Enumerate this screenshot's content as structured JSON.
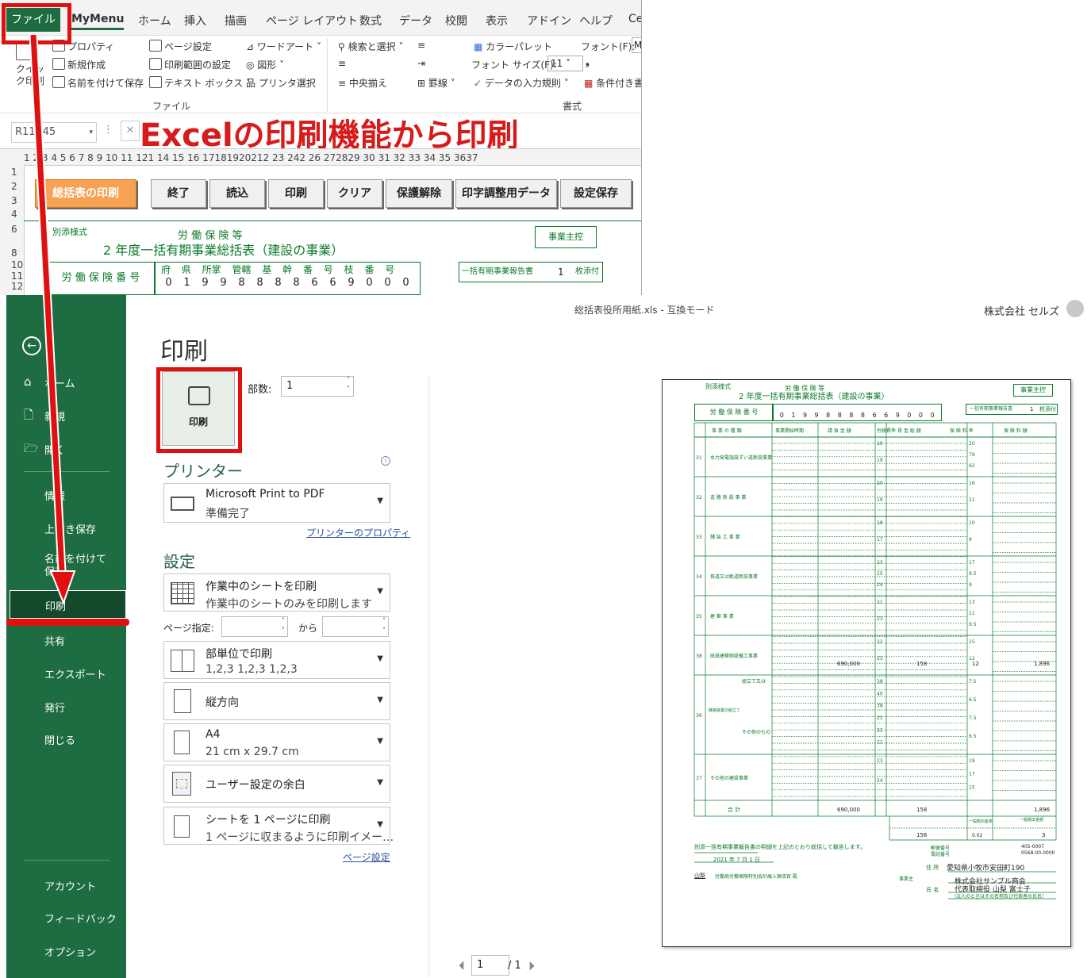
{
  "ribbon": {
    "tabs": [
      "ファイル",
      "MyMenu",
      "ホーム",
      "挿入",
      "描画",
      "ページ レイアウト",
      "数式",
      "データ",
      "校閲",
      "表示",
      "アドイン",
      "ヘルプ",
      "Ce"
    ],
    "quick_print": "クイック印刷",
    "file_group": [
      "プロパティ",
      "新規作成",
      "名前を付けて保存",
      "ページ設定",
      "印刷範囲の設定",
      "テキスト ボックス",
      "ワードアート",
      "図形",
      "プリンタ選択"
    ],
    "edit_group": [
      "検索と選択",
      "中央揃え",
      "罫線"
    ],
    "format_group": [
      "カラーパレット",
      "フォント サイズ(F):",
      "11",
      "データの入力規則",
      "フォント(F):",
      "M",
      "条件付き書"
    ],
    "group_file": "ファイル",
    "group_format": "書式",
    "name_box": "R11C45",
    "col_numbers": "1 2   3   4 5 6 7 8  9  10 11 121 14 15 16 17181920212 23 242 26 272829  30   31 32 33  34   35 3637",
    "overlay_title": "Excelの印刷機能から印刷"
  },
  "sheet": {
    "buttons": [
      "総括表の印刷",
      "終了",
      "読込",
      "印刷",
      "クリア",
      "保護解除",
      "印字調整用データ",
      "設定保存"
    ],
    "rows": [
      "1",
      "2",
      "3",
      "4",
      "6",
      "8",
      "10",
      "11",
      "12"
    ],
    "form_label": "別添様式",
    "form_title_top": "労 働 保 険 等",
    "form_title": "2  年度一括有期事業総括表（建設の事業）",
    "jigyo_box": "事業主控",
    "insurance_label": "労 働 保 険 番 号",
    "insurance_headers": [
      "府 県",
      "所掌",
      "管轄",
      "基  幹  番  号",
      "枝  番  号"
    ],
    "insurance_digits": [
      "0",
      "1",
      "9",
      "9",
      "8",
      "8",
      "8",
      "8",
      "6",
      "6",
      "9",
      "0",
      "0",
      "0"
    ],
    "attach_label": "一括有期事業報告書",
    "attach_count": "1",
    "attach_unit": "枚添付"
  },
  "backstage": {
    "window_title": "総括表役所用紙.xls  -  互換モード",
    "company": "株式会社 セルズ",
    "nav": [
      "ホーム",
      "新規",
      "開く",
      "情報",
      "上書き保存",
      "名前を付けて保存",
      "印刷",
      "共有",
      "エクスポート",
      "発行",
      "閉じる",
      "アカウント",
      "フィードバック",
      "オプション"
    ],
    "heading": "印刷",
    "print_button": "印刷",
    "copies_label": "部数:",
    "copies_value": "1",
    "printer_heading": "プリンター",
    "printer_name": "Microsoft Print to PDF",
    "printer_status": "準備完了",
    "printer_props": "プリンターのプロパティ",
    "settings_heading": "設定",
    "settings": [
      {
        "l1": "作業中のシートを印刷",
        "l2": "作業中のシートのみを印刷します"
      },
      {
        "l1": "部単位で印刷",
        "l2": "1,2,3    1,2,3    1,2,3"
      },
      {
        "l1": "縦方向",
        "l2": ""
      },
      {
        "l1": "A4",
        "l2": "21 cm x 29.7 cm"
      },
      {
        "l1": "ユーザー設定の余白",
        "l2": ""
      },
      {
        "l1": "シートを 1 ページに印刷",
        "l2": "1 ページに収まるように印刷イメー…"
      }
    ],
    "pages_label": "ページ指定:",
    "pages_to": "から",
    "page_setup": "ページ設定",
    "page_current": "1",
    "page_total": "/ 1"
  },
  "preview": {
    "label": "別添様式",
    "title_top": "労 働 保 険 等",
    "title": "2  年度一括有期事業総括表（建設の事業）",
    "box": "事業主控",
    "insurance_label": "労 働 保 険 番 号",
    "digits": [
      "0",
      "1",
      "9",
      "9",
      "8",
      "8",
      "8",
      "8",
      "6",
      "6",
      "9",
      "0",
      "0",
      "0"
    ],
    "attach": "一括有期事業報告書",
    "attach_count": "1",
    "attach_unit": "枚添付",
    "headers": [
      "事 業 の 種 類",
      "事業開始時期",
      "請 負 金 額",
      "労務費率",
      "賃 金 総 額",
      "保 険 料 率",
      "保 険 料 額"
    ],
    "rows": [
      {
        "code": "31",
        "name": "水力発電施設ずい道新設事業",
        "rates": [
          "19",
          "19"
        ],
        "prate": [
          "20",
          "79",
          "62"
        ]
      },
      {
        "code": "32",
        "name": "道 路 新 設 事 業",
        "rates": [
          "20",
          "19"
        ],
        "prate": [
          "16",
          "11"
        ]
      },
      {
        "code": "33",
        "name": "舗 装 工 事 業",
        "rates": [
          "18",
          "17"
        ],
        "prate": [
          "10",
          "9"
        ]
      },
      {
        "code": "34",
        "name": "鉄道又は軌道新設事業",
        "rates": [
          "23",
          "25",
          "24"
        ],
        "prate": [
          "17",
          "9.5",
          "9"
        ]
      },
      {
        "code": "35",
        "name": "建 築 事 業",
        "rates": [
          "21",
          "23"
        ],
        "prate": [
          "13",
          "11",
          "9.5"
        ]
      },
      {
        "code": "38",
        "name": "既設建築物設備工事業",
        "rates": [
          "22",
          "23"
        ],
        "prate": [
          "15",
          "12"
        ]
      },
      {
        "code": "36",
        "name": "機械装置の組立て又は据付けの事業",
        "rates": [
          "38",
          "40",
          "38",
          "21",
          "22",
          "21"
        ],
        "prate": [
          "7.5",
          "6.5",
          "7.5",
          "6.5"
        ]
      },
      {
        "code": "37",
        "name": "その他の建設事業",
        "rates": [
          "23",
          "24"
        ],
        "prate": [
          "19",
          "17",
          "15"
        ]
      }
    ],
    "sub36a": "組立て又は取付けに関するもの",
    "sub36b": "その他のもの",
    "row38_amount": "690,000",
    "row38_wage": "158",
    "row38_rate": "12",
    "row38_fee": "1,896",
    "total_label": "合   計",
    "total_amount": "690,000",
    "total_wage": "158",
    "total_fee": "1,896",
    "general_label": "一般拠出金率",
    "general_label2": "一般拠出金額",
    "general_wage": "158",
    "general_rate": "0.02",
    "general_fee": "3",
    "note": "別添一括有期事業報告書の明細を上記のとおり総括して報告します。",
    "date": "2021  年  7  月  1  日",
    "office": "山梨",
    "office_suffix": "労働局労働保険特別会計歳入徴収官  殿",
    "postal": "405-0007",
    "phone": "0568-00-0000",
    "zip_label": "郵便番号",
    "tel_label": "電話番号",
    "addr_label": "住   所",
    "address": "愛知県小牧市安田町190",
    "owner_label": "事業主",
    "name_label": "氏   名",
    "company": "株式会社サンプル商会",
    "rep": "代表取締役  山梨  富士子",
    "corp_note": "（法人のときはその名称及び代表者の氏名）"
  }
}
